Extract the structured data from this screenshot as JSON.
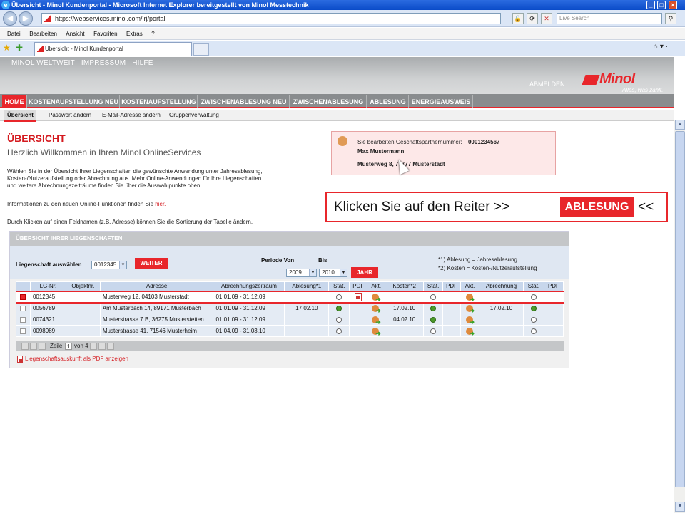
{
  "window": {
    "title": "Übersicht - Minol Kundenportal - Microsoft Internet Explorer bereitgestellt von Minol Messtechnik",
    "minimize": "_",
    "maximize": "□",
    "close": "×"
  },
  "addressbar": {
    "url": "https://webservices.minol.com/irj/portal",
    "search_placeholder": "Live Search"
  },
  "menubar": [
    "Datei",
    "Bearbeiten",
    "Ansicht",
    "Favoriten",
    "Extras",
    "?"
  ],
  "tab": {
    "title": "Übersicht - Minol Kundenportal"
  },
  "site": {
    "topnav": [
      "MINOL WELTWEIT",
      "IMPRESSUM",
      "HILFE"
    ],
    "logout": "ABMELDEN",
    "logo_text": "Minol",
    "logo_slogan": "Alles, was zählt.",
    "accent": "#e8262b"
  },
  "mainnav": [
    "HOME",
    "KOSTENAUFSTELLUNG NEU",
    "KOSTENAUFSTELLUNG",
    "ZWISCHENABLESUNG NEU",
    "ZWISCHENABLESUNG",
    "ABLESUNG",
    "ENERGIEAUSWEIS"
  ],
  "subnav": [
    "Übersicht",
    "Passwort ändern",
    "E-Mail-Adresse ändern",
    "Gruppenverwaltung"
  ],
  "content": {
    "heading": "ÜBERSICHT",
    "subheading": "Herzlich Willkommen in Ihren Minol OnlineServices",
    "intro_lines": [
      "Wählen Sie in der Übersicht Ihrer Liegenschaften die gewünschte Anwendung unter Jahresablesung,",
      "Kosten-/Nutzeraufstellung oder Abrechnung aus. Mehr Online-Anwendungen für Ihre Liegenschaften",
      "und weitere Abrechnungszeiträume finden Sie über die Auswahlpunkte oben."
    ],
    "info_text": "Informationen zu den neuen Online-Funktionen finden Sie",
    "info_link": "hier.",
    "sort_hint": "Durch Klicken auf einen Feldnamen (z.B. Adresse) können Sie die Sortierung der Tabelle ändern."
  },
  "partner": {
    "label": "Sie bearbeiten Geschäftspartnernummer:",
    "number": "0001234567",
    "name": "Max Mustermann",
    "address": "Musterweg 8, 77777 Musterstadt"
  },
  "callout": {
    "text": "Klicken Sie auf den Reiter >>",
    "badge": "ABLESUNG",
    "end": "<<"
  },
  "overview": {
    "title": "ÜBERSICHT IHRER LIEGENSCHAFTEN",
    "select_label": "Liegenschaft auswählen",
    "selected": "0012345",
    "weiter": "WEITER",
    "periode_von": "Periode Von",
    "bis": "Bis",
    "year_from": "2009",
    "year_to": "2010",
    "jahr": "JAHR",
    "notes": [
      "*1) Ablesung = Jahresablesung",
      "*2) Kosten = Kosten-/Nutzeraufstellung"
    ],
    "columns": [
      "",
      "LG-Nr.",
      "Objektnr.",
      "Adresse",
      "Abrechnungszeitraum",
      "Ablesung*1",
      "Stat.",
      "PDF",
      "Akt.",
      "Kosten*2",
      "Stat.",
      "PDF",
      "Akt.",
      "Abrechnung",
      "Stat.",
      "PDF"
    ],
    "rows": [
      {
        "lg": "0012345",
        "obj": "",
        "addr": "Musterweg 12, 04103 Musterstadt",
        "period": "01.01.09 - 31.12.09",
        "abl": "",
        "kosten": "",
        "abr": ""
      },
      {
        "lg": "0056789",
        "obj": "",
        "addr": "Am Musterbach 14, 89171 Musterbach",
        "period": "01.01.09 - 31.12.09",
        "abl": "17.02.10",
        "kosten": "17.02.10",
        "abr": "17.02.10"
      },
      {
        "lg": "0074321",
        "obj": "",
        "addr": "Musterstrasse 7 B, 36275 Musterstetten",
        "period": "01.01.09 - 31.12.09",
        "abl": "",
        "kosten": "04.02.10",
        "abr": ""
      },
      {
        "lg": "0098989",
        "obj": "",
        "addr": "Musterstrasse 41, 71546 Musterheim",
        "period": "01.04.09 - 31.03.10",
        "abl": "",
        "kosten": "",
        "abr": ""
      }
    ],
    "pager_zeile": "Zeile",
    "pager_page": "1",
    "pager_von": "von 4",
    "pdf_link": "Liegenschaftsauskunft als PDF anzeigen"
  }
}
